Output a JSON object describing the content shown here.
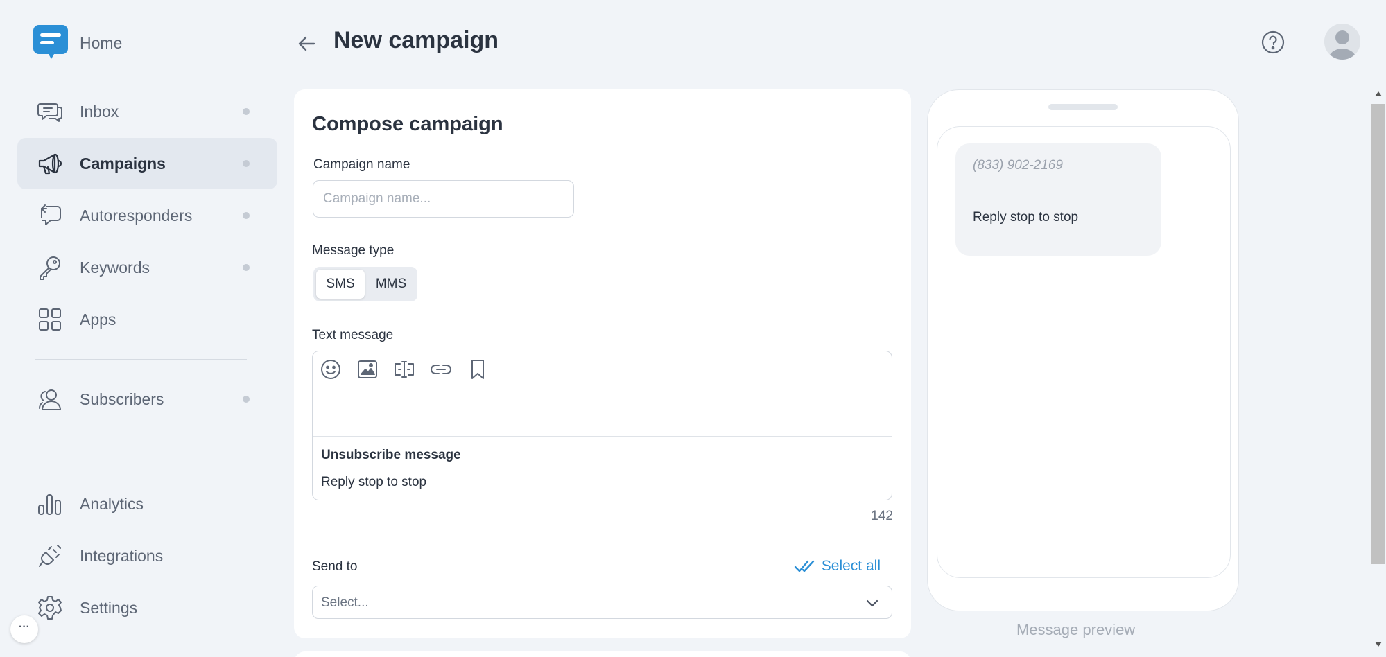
{
  "brand": {
    "home_label": "Home",
    "accent": "#2b8fd6"
  },
  "sidebar": {
    "items": [
      {
        "label": "Inbox",
        "icon": "chat-bubbles-icon"
      },
      {
        "label": "Campaigns",
        "icon": "megaphone-icon",
        "active": true
      },
      {
        "label": "Autoresponders",
        "icon": "autoresponder-icon"
      },
      {
        "label": "Keywords",
        "icon": "key-icon"
      },
      {
        "label": "Apps",
        "icon": "grid-icon"
      },
      {
        "label": "Subscribers",
        "icon": "users-icon"
      },
      {
        "label": "Analytics",
        "icon": "bar-chart-icon"
      },
      {
        "label": "Integrations",
        "icon": "plug-icon"
      },
      {
        "label": "Settings",
        "icon": "gear-icon"
      }
    ],
    "more_label": "···"
  },
  "header": {
    "title": "New campaign"
  },
  "compose": {
    "title": "Compose campaign",
    "campaign_name_label": "Campaign name",
    "campaign_name_placeholder": "Campaign name...",
    "campaign_name_value": "",
    "message_type_label": "Message type",
    "message_types": [
      "SMS",
      "MMS"
    ],
    "message_type_selected": "SMS",
    "text_message_label": "Text message",
    "unsubscribe_label": "Unsubscribe message",
    "unsubscribe_text": "Reply stop to stop",
    "char_count": "142",
    "send_to_label": "Send to",
    "select_all_label": "Select all",
    "send_to_placeholder": "Select..."
  },
  "preview": {
    "phone_number": "(833) 902-2169",
    "message": "Reply stop to stop",
    "caption": "Message preview"
  }
}
